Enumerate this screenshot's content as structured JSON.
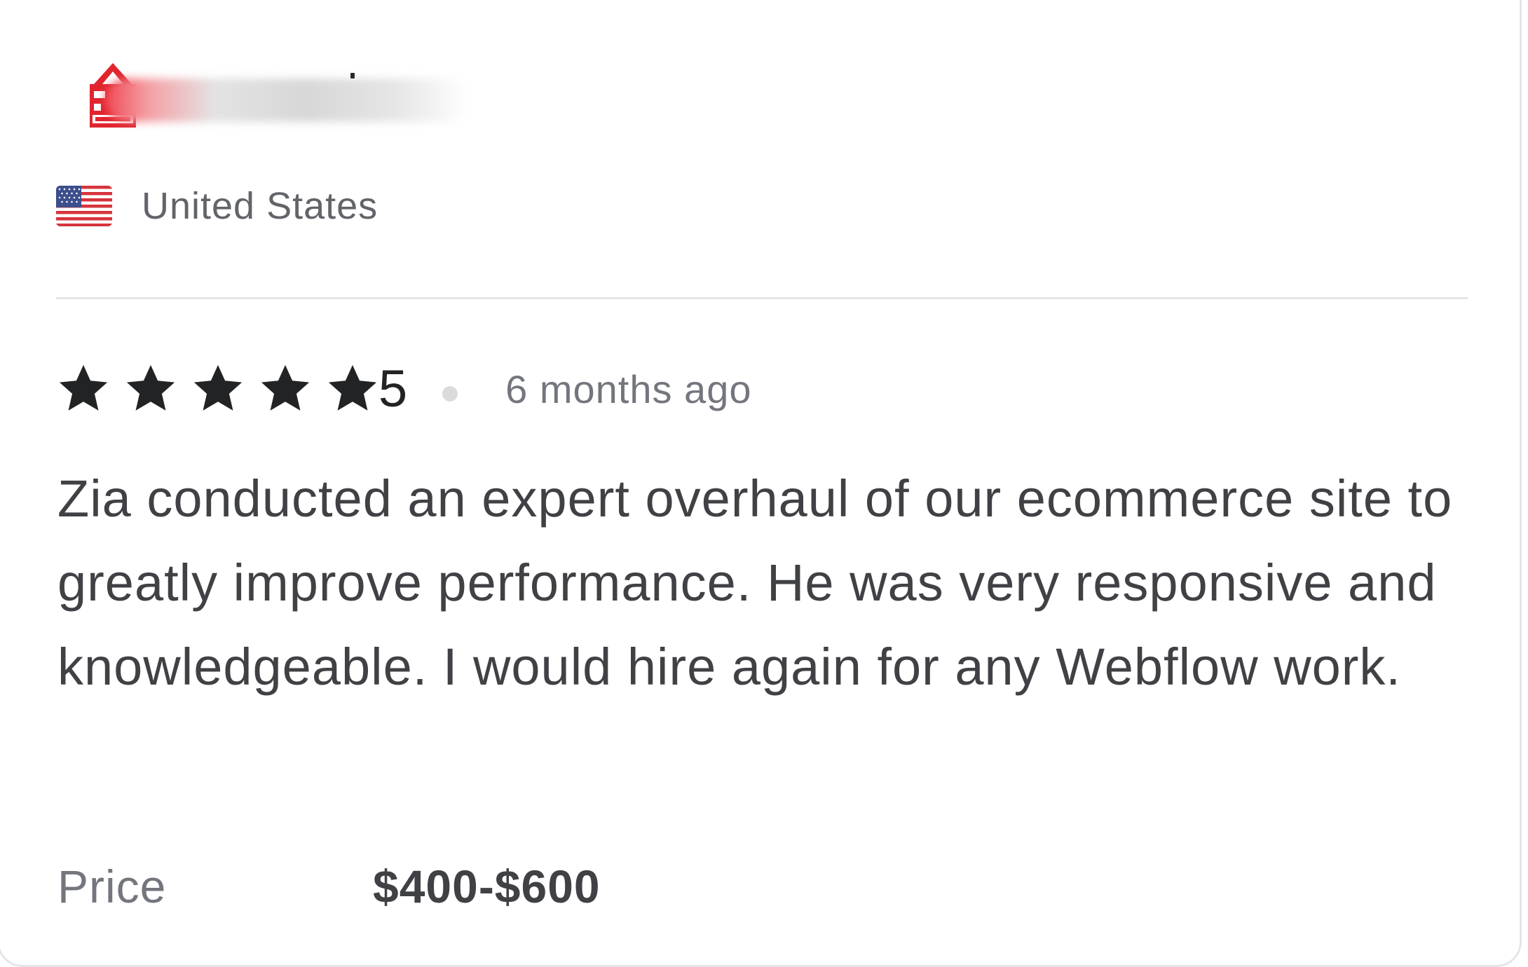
{
  "reviewer": {
    "country": "United States",
    "flag_icon": "us-flag-icon"
  },
  "rating": {
    "stars": 5,
    "value": "5",
    "star_color": "#222325",
    "time_ago": "6 months ago"
  },
  "review": {
    "text": "Zia conducted an expert overhaul of our ecommerce site to greatly improve performance. He was very responsive and knowledgeable. I would hire again for any Webflow work."
  },
  "price": {
    "label": "Price",
    "value": "$400-$600"
  },
  "colors": {
    "logo_red": "#e0252f",
    "text_dark": "#404145",
    "text_muted": "#74767e",
    "divider": "#e4e5e7"
  }
}
